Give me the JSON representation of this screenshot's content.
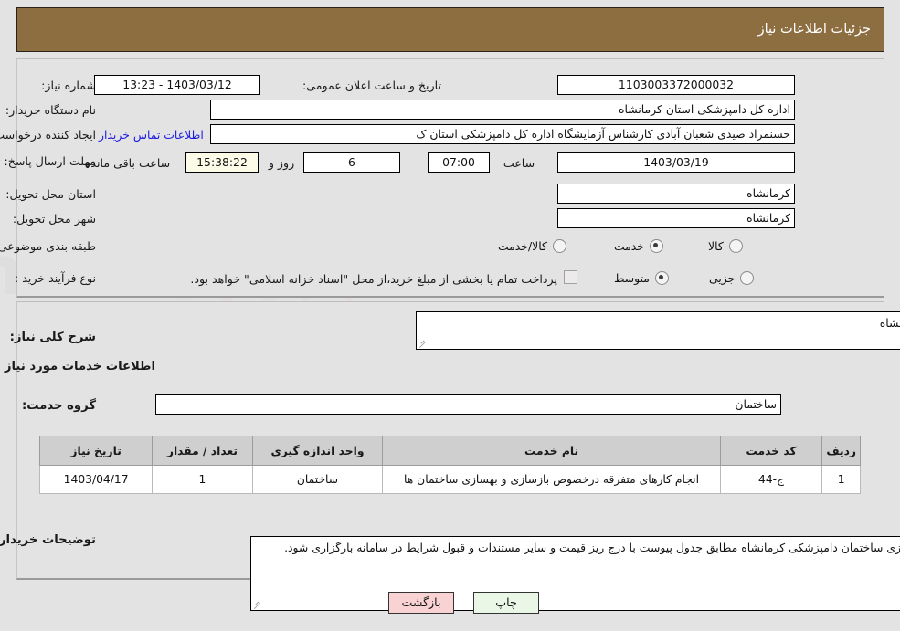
{
  "header": {
    "title": "جزئیات اطلاعات نیاز"
  },
  "watermark": {
    "text": "AnaTender.net"
  },
  "top_form": {
    "need_number": {
      "label": "شماره نیاز:",
      "value": "1103003372000032"
    },
    "announce_datetime": {
      "label": "تاریخ و ساعت اعلان عمومی:",
      "value": "1403/03/12 - 13:23"
    },
    "buyer_org": {
      "label": "نام دستگاه خریدار:",
      "value": "اداره کل دامپزشکی استان کرمانشاه"
    },
    "requester": {
      "label": "ایجاد کننده درخواست:",
      "value": "حسنمراد صیدی شعبان آبادی کارشناس آزمایشگاه اداره کل دامپزشکی استان ک",
      "contact_link": "اطلاعات تماس خریدار"
    },
    "deadline": {
      "label": "مهلت ارسال پاسخ: تا تاریخ:",
      "date_value": "1403/03/19",
      "time_label": "ساعت",
      "time_value": "07:00",
      "days_value": "6",
      "days_label": "روز و",
      "countdown_value": "15:38:22",
      "countdown_label": "ساعت باقی مانده"
    },
    "delivery_province": {
      "label": "استان محل تحویل:",
      "value": "کرمانشاه"
    },
    "delivery_city": {
      "label": "شهر محل تحویل:",
      "value": "کرمانشاه"
    },
    "category": {
      "label": "طبقه بندی موضوعی:",
      "options": [
        {
          "label": "کالا",
          "selected": false
        },
        {
          "label": "خدمت",
          "selected": true
        },
        {
          "label": "کالا/خدمت",
          "selected": false
        }
      ]
    },
    "purchase_process": {
      "label": "نوع فرآیند خرید :",
      "options": [
        {
          "label": "جزیی",
          "selected": false
        },
        {
          "label": "متوسط",
          "selected": true
        }
      ],
      "treasury_checkbox_checked": false,
      "treasury_text": "پرداخت تمام یا بخشی از مبلغ خرید،از محل \"اسناد خزانه اسلامی\" خواهد بود."
    }
  },
  "bottom_form": {
    "general_desc": {
      "label": "شرح کلی نیاز:",
      "value": "تعمیر ساختمان دامپزشکی کرمانشاه"
    },
    "section_title": "اطلاعات خدمات مورد نیاز",
    "service_group": {
      "label": "گروه خدمت:",
      "value": "ساختمان"
    },
    "table": {
      "columns": [
        "ردیف",
        "کد خدمت",
        "نام خدمت",
        "واحد اندازه گیری",
        "تعداد / مقدار",
        "تاریخ نیاز"
      ],
      "rows": [
        {
          "row_no": "1",
          "service_code": "ج-44",
          "service_name": "انجام کارهای متفرقه درخصوص بازسازی و بهسازی ساختمان ها",
          "unit": "ساختمان",
          "quantity": "1",
          "need_date": "1403/04/17"
        }
      ]
    },
    "buyer_notes": {
      "label": "توضیحات خریدار:",
      "value": "تعمیر و بهسازی ساختمان دامپزشکی کرمانشاه مطابق جدول پیوست با درج ریز قیمت و سایر مستندات و قبول شرایط در سامانه بارگزاری شود."
    }
  },
  "footer": {
    "back_button": "بازگشت",
    "print_button": "چاپ"
  },
  "colors": {
    "header_brown": "#8d6e41",
    "page_bg": "#e3e3e3",
    "link_blue": "#1a1ae0",
    "back_btn_bg": "#f9d3d3",
    "print_btn_bg": "#eaf7e7",
    "table_header_bg": "#cfcfcf",
    "countdown_bg": "#fcfbe8"
  }
}
